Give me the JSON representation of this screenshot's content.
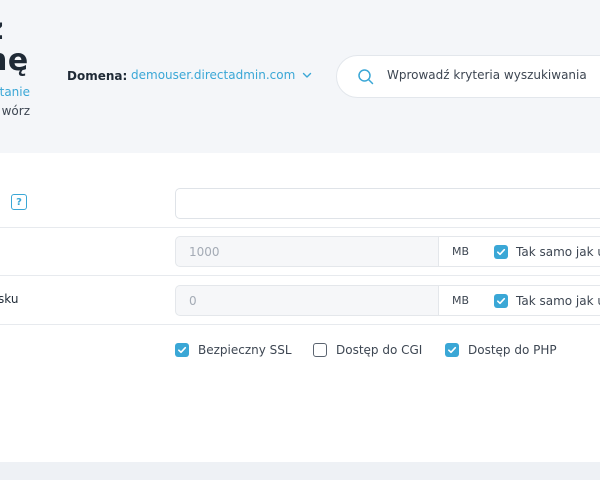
{
  "header": {
    "title_line1": "z",
    "title_line2": "nę",
    "title_link": "tanie",
    "title_sub": "wórz",
    "domain_label": "Domena:",
    "domain_value": "demouser.directadmin.com"
  },
  "search": {
    "placeholder": "Wprowadź kryteria wyszukiwania",
    "value": ""
  },
  "form": {
    "help_label": "?",
    "name_value": "",
    "row2": {
      "value": "1000",
      "unit": "MB",
      "same_label": "Tak samo jak u"
    },
    "row3": {
      "label": "sku",
      "value": "0",
      "unit": "MB",
      "same_label": "Tak samo jak u"
    },
    "options": [
      {
        "label": "Bezpieczny SSL",
        "checked": true
      },
      {
        "label": "Dostęp do CGI",
        "checked": false
      },
      {
        "label": "Dostęp do PHP",
        "checked": true
      }
    ]
  },
  "colors": {
    "accent": "#3aa7d6",
    "background": "#f4f6f9",
    "panel": "#ffffff",
    "text": "#1f2a36"
  },
  "icons": [
    "chevron-down-icon",
    "search-icon",
    "help-icon",
    "check-icon"
  ]
}
